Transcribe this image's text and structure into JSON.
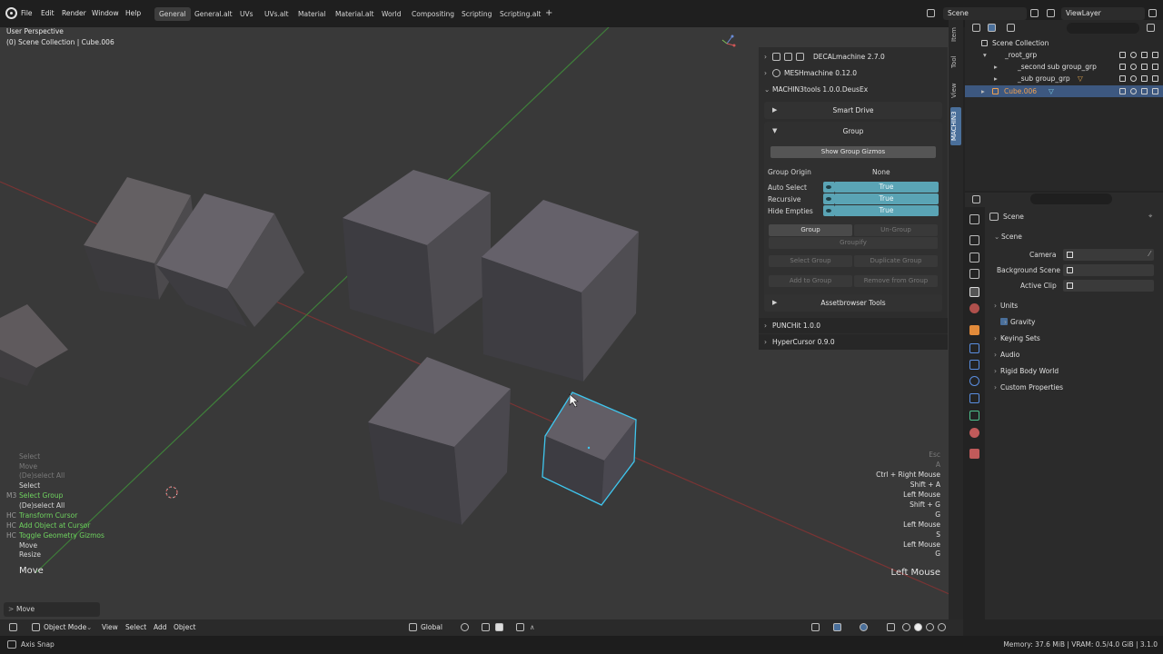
{
  "menu": [
    "File",
    "Edit",
    "Render",
    "Window",
    "Help"
  ],
  "workspaces": [
    "General",
    "General.alt",
    "UVs",
    "UVs.alt",
    "Material",
    "Material.alt",
    "World",
    "Compositing",
    "Scripting",
    "Scripting.alt"
  ],
  "active_workspace": "General",
  "scene_name": "Scene",
  "view_layer": "ViewLayer",
  "viewport": {
    "view_name": "User Perspective",
    "collection_info": "(0) Scene Collection | Cube.006",
    "operator_label": "Move",
    "operator_key": "Left Mouse",
    "redo_panel": "Move"
  },
  "keymap_hints_left": [
    {
      "prefix": "",
      "label": "Select",
      "style": "dim"
    },
    {
      "prefix": "",
      "label": "Move",
      "style": "dim"
    },
    {
      "prefix": "",
      "label": "(De)select All",
      "style": "dim"
    },
    {
      "prefix": "",
      "label": "Select",
      "style": "normal"
    },
    {
      "prefix": "M3",
      "label": "Select Group",
      "style": "green"
    },
    {
      "prefix": "",
      "label": "(De)select All",
      "style": "normal"
    },
    {
      "prefix": "HC",
      "label": "Transform Cursor",
      "style": "green"
    },
    {
      "prefix": "HC",
      "label": "Add Object at Cursor",
      "style": "green"
    },
    {
      "prefix": "HC",
      "label": "Toggle Geometry Gizmos",
      "style": "green"
    },
    {
      "prefix": "",
      "label": "Move",
      "style": "normal"
    },
    {
      "prefix": "",
      "label": "Resize",
      "style": "normal"
    }
  ],
  "keymap_hints_right": [
    {
      "label": "Esc",
      "style": "dim"
    },
    {
      "label": "A",
      "style": "dim"
    },
    {
      "label": "Ctrl + Right Mouse",
      "style": "normal"
    },
    {
      "label": "Shift + A",
      "style": "normal"
    },
    {
      "label": "Left Mouse",
      "style": "normal"
    },
    {
      "label": "Shift + G",
      "style": "normal"
    },
    {
      "label": "G",
      "style": "normal"
    },
    {
      "label": "Left Mouse",
      "style": "normal"
    },
    {
      "label": "S",
      "style": "normal"
    },
    {
      "label": "Left Mouse",
      "style": "normal"
    },
    {
      "label": "G",
      "style": "normal"
    }
  ],
  "npanel": {
    "addons": [
      "DECALmachine 2.7.0",
      "MESHmachine 0.12.0",
      "MACHIN3tools 1.0.0.DeusEx"
    ],
    "smart_drive": "Smart Drive",
    "group_title": "Group",
    "show_group_gizmos": "Show Group Gizmos",
    "group_origin_label": "Group Origin",
    "group_origin_value": "None",
    "toggles": [
      {
        "label": "Auto Select",
        "value": "True"
      },
      {
        "label": "Recursive",
        "value": "True"
      },
      {
        "label": "Hide Empties",
        "value": "True"
      }
    ],
    "group_btn": "Group",
    "ungroup_btn": "Un-Group",
    "groupify_btn": "Groupify",
    "select_group_btn": "Select Group",
    "duplicate_group_btn": "Duplicate Group",
    "add_to_group_btn": "Add to Group",
    "remove_from_group_btn": "Remove from Group",
    "assetbrowser_tools": "Assetbrowser Tools",
    "punchit": "PUNCHit 1.0.0",
    "hypercursor": "HyperCursor 0.9.0"
  },
  "side_tabs": [
    "Item",
    "Tool",
    "View",
    "MACHIN3"
  ],
  "outliner": {
    "root": "Scene Collection",
    "items": [
      {
        "name": "_root_grp",
        "indent": 1,
        "selected": false
      },
      {
        "name": "_second sub group_grp",
        "indent": 2,
        "selected": false
      },
      {
        "name": "_sub group_grp",
        "indent": 2,
        "selected": false
      },
      {
        "name": "Cube.006",
        "indent": 1,
        "selected": true
      }
    ]
  },
  "properties": {
    "context": "Scene",
    "panel_title": "Scene",
    "fields": [
      {
        "label": "Camera"
      },
      {
        "label": "Background Scene"
      },
      {
        "label": "Active Clip"
      }
    ],
    "sections": [
      "Units",
      "Gravity",
      "Keying Sets",
      "Audio",
      "Rigid Body World",
      "Custom Properties"
    ]
  },
  "header_bottom": {
    "mode": "Object Mode",
    "menus": [
      "View",
      "Select",
      "Add",
      "Object"
    ],
    "orientation": "Global"
  },
  "status": {
    "left": "Axis Snap",
    "right": "Memory: 37.6 MiB | VRAM: 0.5/4.0 GiB | 3.1.0"
  },
  "colors": {
    "accent_blue": "#4a6f9a",
    "toggle_true": "#5aa4b5",
    "selection_outline": "#3fc6ee",
    "addon_green": "#6fd35f"
  }
}
